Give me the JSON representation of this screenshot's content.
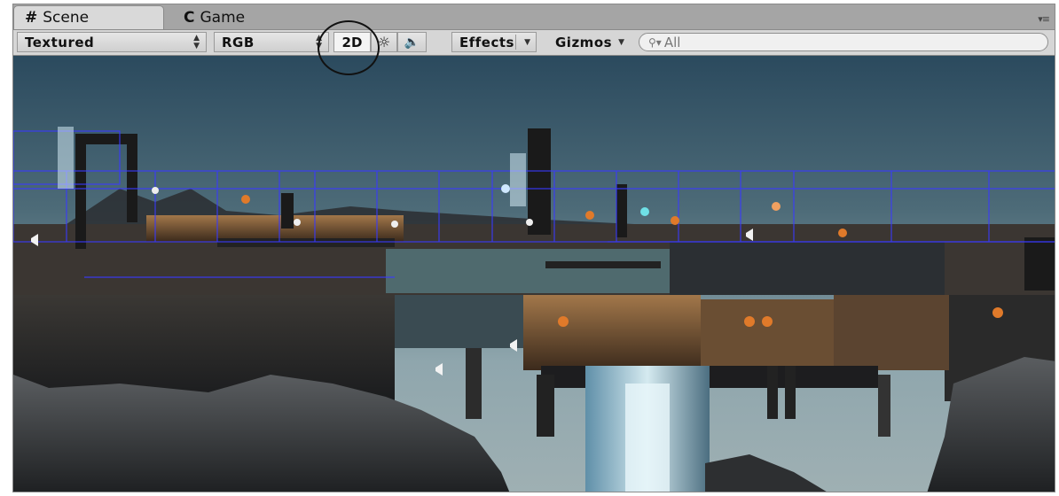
{
  "tabs": [
    {
      "icon": "#",
      "label": "Scene"
    },
    {
      "icon": "C",
      "label": "Game"
    }
  ],
  "tab_menu_icon": "▾≡",
  "toolbar": {
    "render_mode": "Textured",
    "color_mode": "RGB",
    "mode_2d_label": "2D",
    "lighting_icon": "☼",
    "audio_icon": "🔈",
    "effects_label": "Effects",
    "gizmos_label": "Gizmos",
    "search_placeholder": "All"
  },
  "colors": {
    "sky_top": "#2b4a5e",
    "sky_bottom": "#8fa6ad",
    "grid_lines": "#3a3aff",
    "light_orange": "#e07a2a",
    "light_cyan": "#6fe0e6"
  }
}
